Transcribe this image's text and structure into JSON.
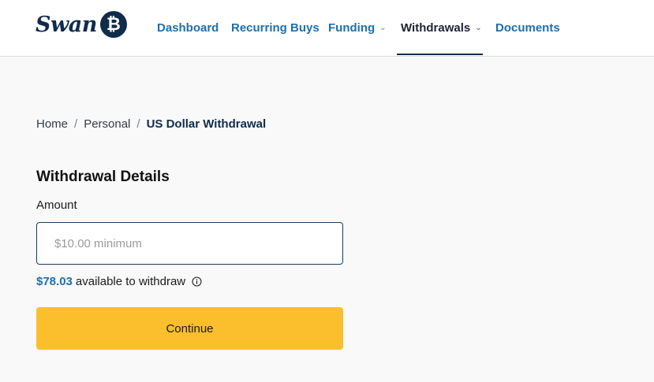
{
  "brand": {
    "name": "Swan",
    "icon": "bitcoin-icon"
  },
  "nav": {
    "items": [
      {
        "label": "Dashboard",
        "dropdown": false,
        "active": false
      },
      {
        "label": "Recurring Buys",
        "dropdown": false,
        "active": false
      },
      {
        "label": "Funding",
        "dropdown": true,
        "active": false
      },
      {
        "label": "Withdrawals",
        "dropdown": true,
        "active": true
      },
      {
        "label": "Documents",
        "dropdown": false,
        "active": false
      }
    ]
  },
  "breadcrumb": {
    "items": [
      "Home",
      "Personal"
    ],
    "current": "US Dollar Withdrawal",
    "separator": "/"
  },
  "form": {
    "title": "Withdrawal Details",
    "amount_label": "Amount",
    "amount_placeholder": "$10.00 minimum",
    "amount_value": "",
    "available_amount": "$78.03",
    "available_text": "available to withdraw",
    "continue_label": "Continue"
  },
  "colors": {
    "brand_navy": "#0f2c4b",
    "link_blue": "#1e6fae",
    "button_yellow": "#fbbf2d",
    "page_bg": "#f9f9f9"
  }
}
